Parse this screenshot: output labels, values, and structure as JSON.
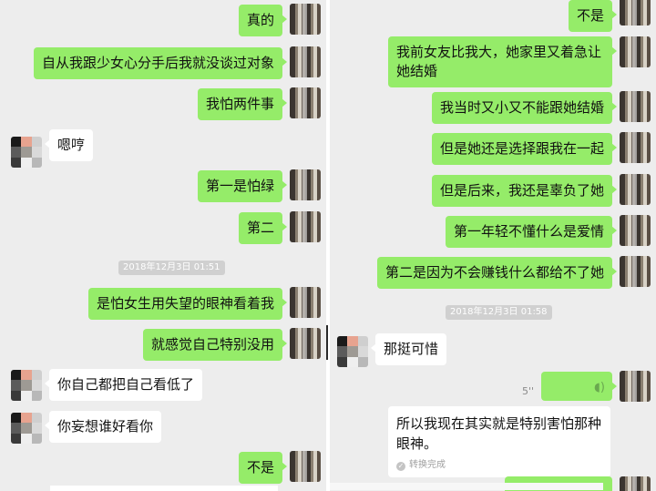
{
  "left_panel": {
    "messages": [
      {
        "text": "真的"
      },
      {
        "text": "自从我跟少女心分手后我就没谈过对象"
      },
      {
        "text": "我怕两件事"
      },
      {
        "text": "嗯哼"
      },
      {
        "text": "第一是怕绿"
      },
      {
        "text": "第二"
      },
      {
        "text": "是怕女生用失望的眼神看着我"
      },
      {
        "text": "就感觉自己特别没用"
      },
      {
        "text": "你自己都把自己看低了"
      },
      {
        "text": "你妄想谁好看你"
      },
      {
        "text": "不是"
      }
    ],
    "timestamp": "2018年12月3日 01:51"
  },
  "right_panel": {
    "messages": [
      {
        "text": "不是"
      },
      {
        "text": "我前女友比我大，她家里又着急让她结婚"
      },
      {
        "text": "我当时又小又不能跟她结婚"
      },
      {
        "text": "但是她还是选择跟我在一起"
      },
      {
        "text": "但是后来，我还是辜负了她"
      },
      {
        "text": "第一年轻不懂什么是爱情"
      },
      {
        "text": "第二是因为不会赚钱什么都给不了她"
      },
      {
        "text": "那挺可惜"
      }
    ],
    "timestamp": "2018年12月3日 01:58",
    "voice": {
      "duration": "5''",
      "transcript": "所以我现在其实就是特别害怕那种眼神。",
      "status": "转换完成"
    }
  },
  "colors": {
    "background": "#ededed",
    "my_bubble": "#95ec69",
    "other_bubble": "#ffffff",
    "timestamp_bg": "#d0d0d0"
  },
  "icons": {
    "voice": "voice-wave-icon",
    "check": "check-circle-icon"
  }
}
